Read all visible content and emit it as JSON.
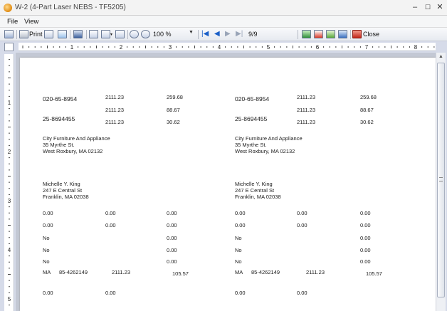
{
  "window": {
    "title": "W-2 (4-Part Laser NEBS - TF5205)"
  },
  "menu": {
    "file": "File",
    "view": "View"
  },
  "toolbar": {
    "print_label": "Print",
    "zoom": "100 %",
    "page_indicator": "9/9",
    "close_label": "Close"
  },
  "ruler": {
    "h_numbers": [
      "1",
      "2",
      "3",
      "4",
      "5",
      "6",
      "7",
      "8"
    ],
    "v_numbers": [
      "1",
      "2",
      "3",
      "4",
      "5"
    ]
  },
  "copies": [
    {
      "employer_id": "020-65-8954",
      "box1": "2111.23",
      "box2": "259.68",
      "box3": "2111.23",
      "box4": "88.67",
      "employee_ssn": "25-8694455",
      "box5": "2111.23",
      "box6": "30.62",
      "employer_name": "City Furniture And Appliance",
      "employer_street": "35 Myrthe St.",
      "employer_city": "West Roxbury, MA 02132",
      "employee_name": "Michelle Y. King",
      "employee_street": "247 E Central St",
      "employee_city": "Franklin, MA 02038",
      "r1": [
        "0.00",
        "0.00",
        "0.00"
      ],
      "r2": [
        "0.00",
        "0.00",
        "0.00"
      ],
      "r3": [
        "No",
        "0.00"
      ],
      "r4": [
        "No",
        "0.00"
      ],
      "r5": [
        "No",
        "0.00"
      ],
      "state": "MA",
      "state_id": "85-4262149",
      "state_wages": "2111.23",
      "state_tax": "105.57",
      "r7": [
        "0.00",
        "0.00"
      ]
    },
    {
      "employer_id": "020-65-8954",
      "box1": "2111.23",
      "box2": "259.68",
      "box3": "2111.23",
      "box4": "88.67",
      "employee_ssn": "25-8694455",
      "box5": "2111.23",
      "box6": "30.62",
      "employer_name": "City Furniture And Appliance",
      "employer_street": "35 Myrthe St.",
      "employer_city": "West Roxbury, MA 02132",
      "employee_name": "Michelle Y. King",
      "employee_street": "247 E Central St",
      "employee_city": "Franklin, MA 02038",
      "r1": [
        "0.00",
        "0.00",
        "0.00"
      ],
      "r2": [
        "0.00",
        "0.00",
        "0.00"
      ],
      "r3": [
        "No",
        "0.00"
      ],
      "r4": [
        "No",
        "0.00"
      ],
      "r5": [
        "No",
        "0.00"
      ],
      "state": "MA",
      "state_id": "85-4262149",
      "state_wages": "2111.23",
      "state_tax": "105.57",
      "r7": [
        "0.00",
        "0.00"
      ]
    }
  ]
}
